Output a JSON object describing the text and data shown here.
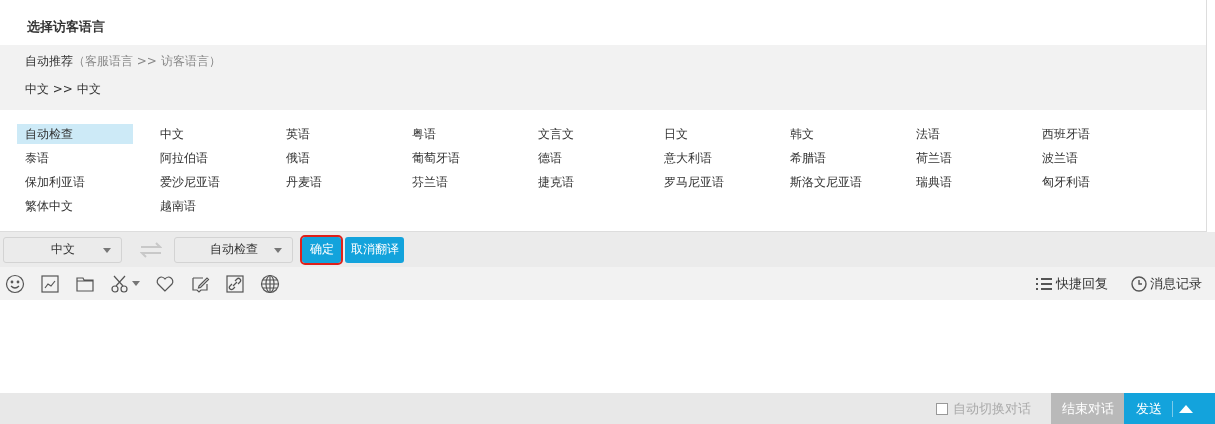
{
  "panel": {
    "title": "选择访客语言",
    "recommend_label": "自动推荐",
    "recommend_hint": "（客服语言 >> 访客语言）",
    "recommend_value": "中文 >> 中文",
    "languages": [
      {
        "label": "自动检查",
        "selected": true
      },
      {
        "label": "中文",
        "selected": false
      },
      {
        "label": "英语",
        "selected": false
      },
      {
        "label": "粤语",
        "selected": false
      },
      {
        "label": "文言文",
        "selected": false
      },
      {
        "label": "日文",
        "selected": false
      },
      {
        "label": "韩文",
        "selected": false
      },
      {
        "label": "法语",
        "selected": false
      },
      {
        "label": "西班牙语",
        "selected": false
      },
      {
        "label": "泰语",
        "selected": false
      },
      {
        "label": "阿拉伯语",
        "selected": false
      },
      {
        "label": "俄语",
        "selected": false
      },
      {
        "label": "葡萄牙语",
        "selected": false
      },
      {
        "label": "德语",
        "selected": false
      },
      {
        "label": "意大利语",
        "selected": false
      },
      {
        "label": "希腊语",
        "selected": false
      },
      {
        "label": "荷兰语",
        "selected": false
      },
      {
        "label": "波兰语",
        "selected": false
      },
      {
        "label": "保加利亚语",
        "selected": false
      },
      {
        "label": "爱沙尼亚语",
        "selected": false
      },
      {
        "label": "丹麦语",
        "selected": false
      },
      {
        "label": "芬兰语",
        "selected": false
      },
      {
        "label": "捷克语",
        "selected": false
      },
      {
        "label": "罗马尼亚语",
        "selected": false
      },
      {
        "label": "斯洛文尼亚语",
        "selected": false
      },
      {
        "label": "瑞典语",
        "selected": false
      },
      {
        "label": "匈牙利语",
        "selected": false
      },
      {
        "label": "繁体中文",
        "selected": false
      },
      {
        "label": "越南语",
        "selected": false
      }
    ]
  },
  "translate_bar": {
    "source": "中文",
    "target": "自动检查",
    "confirm": {
      "label": "确定",
      "outlined": true
    },
    "cancel": "取消翻译"
  },
  "toolbar": {
    "icons": [
      {
        "kind": "smiley"
      },
      {
        "kind": "image"
      },
      {
        "kind": "folder"
      },
      {
        "kind": "scissors"
      },
      {
        "kind": "heart"
      },
      {
        "kind": "edit"
      },
      {
        "kind": "link"
      },
      {
        "kind": "globe"
      }
    ],
    "quick_reply": "快捷回复",
    "history": "消息记录"
  },
  "footer": {
    "auto_switch": {
      "label": "自动切换对话",
      "checked": false
    },
    "end_chat": "结束对话",
    "send": "发送"
  }
}
